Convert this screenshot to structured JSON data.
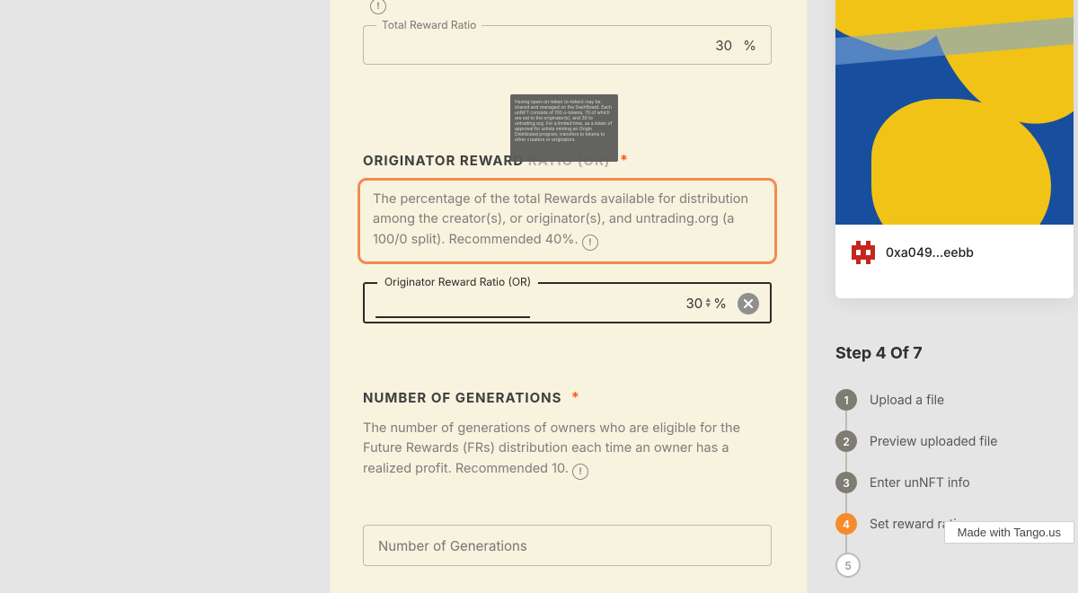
{
  "form": {
    "recommended_prefix": "Recommended 40",
    "info_glyph": "!",
    "total_reward": {
      "legend": "Total Reward Ratio",
      "value": "30",
      "unit": "%"
    },
    "or": {
      "heading_a": "ORIGINATOR REWARD",
      "heading_b": "RATIO (OR)",
      "tooltip": "Having open-on-token (o-token) may be shared and managed on the DashBoard. Each unNFT consists of 100 o-tokens, 70 of which are set to the originator(s), and 30 to untrading.org. For a limited time, as a token of approval for artists minting an Origin Distributed program, transfers to tokens to other creators or originators.",
      "desc_a": "The percentage of the total Rewards available for distribution among the creator(s), or originator(s), and untrading.org (a 100/0 split). Recommended 40%.",
      "legend": "Originator Reward Ratio (OR)",
      "value": "30",
      "unit": "%"
    },
    "gen": {
      "heading": "NUMBER OF GENERATIONS",
      "desc": "The number of generations of owners who are eligible for the Future Rewards (FRs) distribution each time an owner has a realized profit. Recommended 10.",
      "placeholder": "Number of Generations",
      "value": ""
    }
  },
  "preview": {
    "address": "0xa049…eebb"
  },
  "stepper": {
    "title": "Step 4 Of 7",
    "steps": [
      {
        "n": "1",
        "label": "Upload a file"
      },
      {
        "n": "2",
        "label": "Preview uploaded file"
      },
      {
        "n": "3",
        "label": "Enter unNFT info"
      },
      {
        "n": "4",
        "label": "Set reward ratios"
      },
      {
        "n": "5",
        "label": ""
      }
    ],
    "active_index": 3
  },
  "footer": {
    "made_with": "Made with Tango.us"
  }
}
